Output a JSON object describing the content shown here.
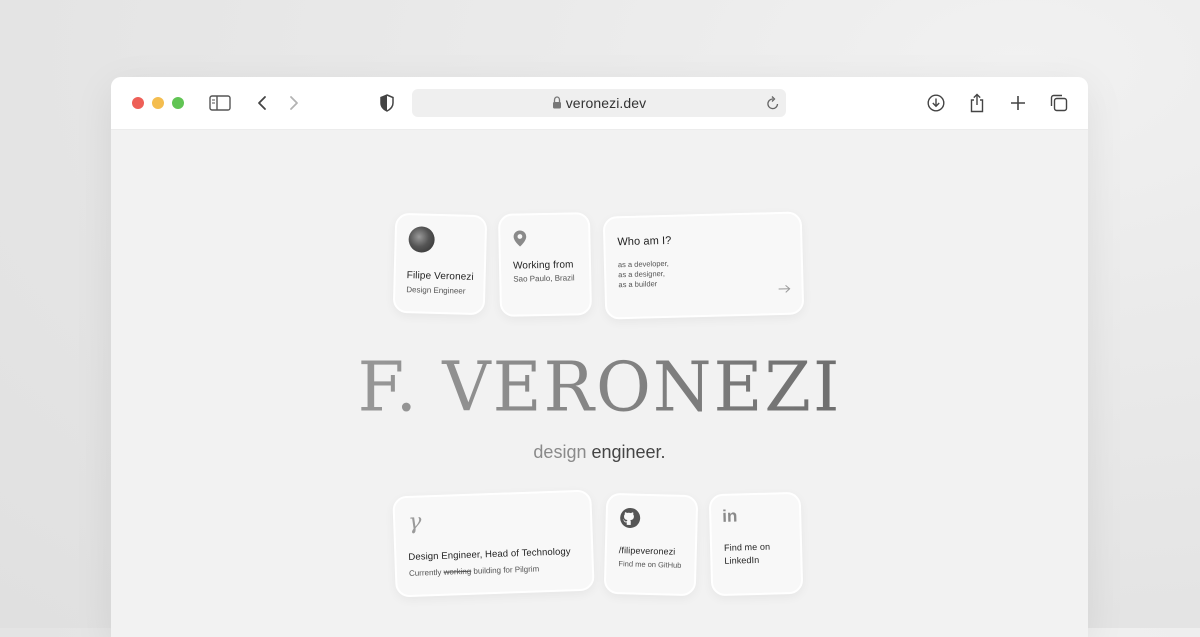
{
  "browser": {
    "url": "veronezi.dev",
    "icons": [
      "sidebar-icon",
      "back-icon",
      "forward-icon",
      "shield-icon",
      "lock-icon",
      "reload-icon",
      "download-icon",
      "share-icon",
      "plus-icon",
      "tabs-icon"
    ]
  },
  "cards": {
    "profile": {
      "name": "Filipe Veronezi",
      "role": "Design Engineer"
    },
    "location": {
      "title": "Working from",
      "place": "Sao Paulo, Brazil"
    },
    "about": {
      "title": "Who am I?",
      "line1": "as a developer,",
      "line2": "as a designer,",
      "line3": "as a builder"
    },
    "pilgrim": {
      "logo": "𝛾",
      "title": "Design Engineer, Head of Technology",
      "prefix": "Currently",
      "struck": "working",
      "suffix": "building for Pilgrim"
    },
    "github": {
      "handle": "/filipeveronezi",
      "caption": "Find me on GitHub"
    },
    "linkedin": {
      "logo": "in",
      "line1": "Find me on",
      "line2": "LinkedIn"
    }
  },
  "hero": {
    "name": "F. VERONEZI",
    "tagline_part1": "design",
    "tagline_part2": "engineer."
  }
}
